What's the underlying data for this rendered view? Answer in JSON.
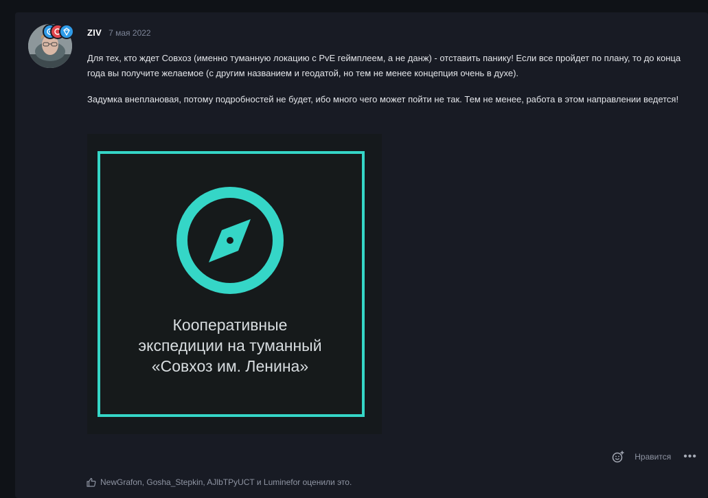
{
  "post": {
    "author": "ZIV",
    "date": "7 мая 2022",
    "paragraphs": [
      "Для тех, кто ждет Совхоз (именно туманную локацию с PvE геймплеем, а не данж) - отставить панику! Если все пройдет по плану, то до конца года вы получите желаемое (с другим названием и геодатой, но тем не менее концепция очень в духе).",
      "Задумка внеплановая, потому подробностей не будет, ибо много чего может пойти не так. Тем не менее, работа в этом направлении ведется!"
    ],
    "image": {
      "caption_lines": [
        "Кооперативные",
        "экспедиции на туманный",
        "«Совхоз им. Ленина»"
      ],
      "accent_color": "#35d6c7",
      "icon": "compass-icon"
    },
    "actions": {
      "react_icon": "add-reaction-icon",
      "like_label": "Нравится",
      "more_label": "•••"
    },
    "likes": {
      "icon": "thumbs-up-icon",
      "text": "NewGrafon, Gosha_Stepkin, AJlbTPyUCT и Luminefor оценили это."
    }
  },
  "colors": {
    "background": "#0f1217",
    "card": "#181b24",
    "badge_blue": "#2f9be8",
    "badge_red": "#e0464e"
  }
}
